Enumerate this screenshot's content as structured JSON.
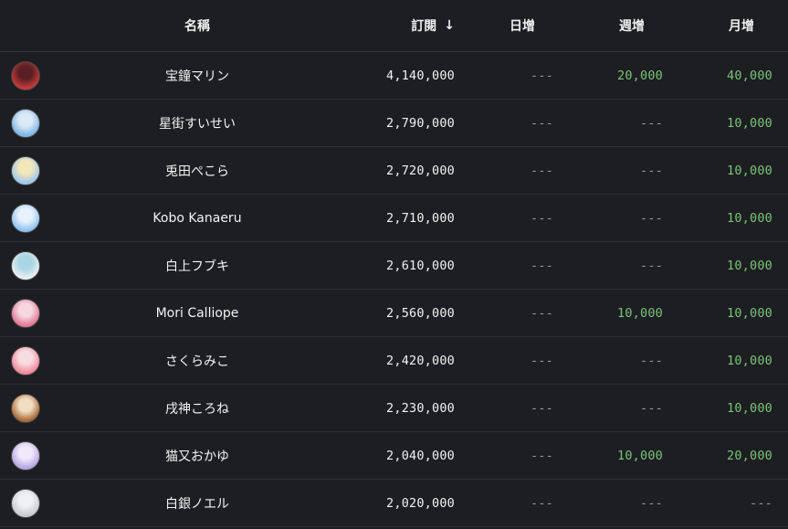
{
  "header": {
    "name": "名稱",
    "subs": "訂閱",
    "day": "日增",
    "week": "週增",
    "month": "月增",
    "sort_icon": "arrow-down-icon"
  },
  "rows": [
    {
      "name": "宝鐘マリン",
      "subs": "4,140,000",
      "day": "---",
      "week": "20,000",
      "month": "40,000",
      "avatar_colors": [
        "#c23a3a",
        "#5a1f22"
      ]
    },
    {
      "name": "星街すいせい",
      "subs": "2,790,000",
      "day": "---",
      "week": "---",
      "month": "10,000",
      "avatar_colors": [
        "#7fb6e6",
        "#dbeaf7"
      ]
    },
    {
      "name": "兎田ぺこら",
      "subs": "2,720,000",
      "day": "---",
      "week": "---",
      "month": "10,000",
      "avatar_colors": [
        "#9fc7ee",
        "#f3e6b8"
      ]
    },
    {
      "name": "Kobo Kanaeru",
      "subs": "2,710,000",
      "day": "---",
      "week": "---",
      "month": "10,000",
      "avatar_colors": [
        "#8fc4f0",
        "#e8f2fb"
      ]
    },
    {
      "name": "白上フブキ",
      "subs": "2,610,000",
      "day": "---",
      "week": "---",
      "month": "10,000",
      "avatar_colors": [
        "#e9eef3",
        "#a9d6e2"
      ]
    },
    {
      "name": "Mori Calliope",
      "subs": "2,560,000",
      "day": "---",
      "week": "10,000",
      "month": "10,000",
      "avatar_colors": [
        "#e27a98",
        "#f6d6df"
      ]
    },
    {
      "name": "さくらみこ",
      "subs": "2,420,000",
      "day": "---",
      "week": "---",
      "month": "10,000",
      "avatar_colors": [
        "#f08a9c",
        "#f7dce2"
      ]
    },
    {
      "name": "戌神ころね",
      "subs": "2,230,000",
      "day": "---",
      "week": "---",
      "month": "10,000",
      "avatar_colors": [
        "#a86b3c",
        "#f1ddc2"
      ]
    },
    {
      "name": "猫又おかゆ",
      "subs": "2,040,000",
      "day": "---",
      "week": "10,000",
      "month": "20,000",
      "avatar_colors": [
        "#b9a6e2",
        "#efe9fb"
      ]
    },
    {
      "name": "白銀ノエル",
      "subs": "2,020,000",
      "day": "---",
      "week": "---",
      "month": "---",
      "avatar_colors": [
        "#c9ccd3",
        "#eff0f3"
      ]
    }
  ],
  "colors": {
    "background": "#1d1e21",
    "green": "#79c57a",
    "dash": "#9a9a9a"
  }
}
